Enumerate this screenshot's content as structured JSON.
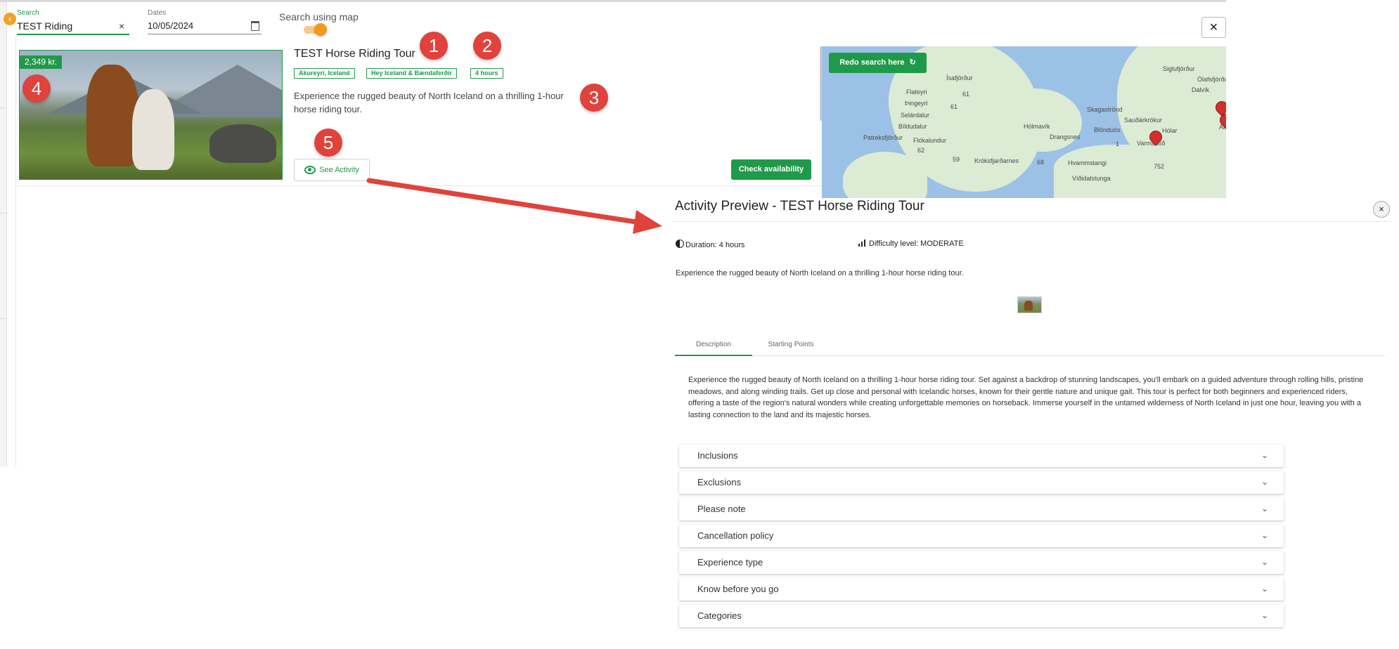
{
  "search": {
    "label": "Search",
    "value": "TEST Riding",
    "clear_icon": "×",
    "dates_label": "Dates",
    "dates_value": "10/05/2024",
    "map_toggle_label": "Search using map",
    "map_toggle_on": true,
    "close_icon": "×"
  },
  "result": {
    "price": "2,349 kr.",
    "title": "TEST Horse Riding Tour",
    "tags": [
      "Akureyri, Iceland",
      "Hey Iceland & Bændaferðir",
      "4 hours"
    ],
    "description": "Experience the rugged beauty of North Iceland on a thrilling 1-hour horse riding tour.",
    "see_activity_label": "See Activity",
    "check_availability_label": "Check availability"
  },
  "map": {
    "redo_label": "Redo search here",
    "places": [
      "Siglufjörður",
      "Ólafsfjörður",
      "Dalvík",
      "Ísafjörður",
      "Flateyri",
      "Þingeyri",
      "Hólmavík",
      "Skagaströnd",
      "Sauðárkrókur",
      "Selárdalur",
      "Bíldudalur",
      "Blönduós",
      "Hólar",
      "Patreksfjörður",
      "Flókalundur",
      "Drangsnes",
      "Varmahlíð",
      "Hvammstangi",
      "Króksfjarðarnes",
      "Víðidalstunga",
      "Ak"
    ],
    "roads": [
      "61",
      "61",
      "1",
      "59",
      "68",
      "62",
      "752"
    ]
  },
  "callouts": [
    "1",
    "2",
    "3",
    "4",
    "5"
  ],
  "preview": {
    "title": "Activity Preview - TEST Horse Riding Tour",
    "duration": "Duration: 4 hours",
    "difficulty": "Difficulty level: MODERATE",
    "short_description": "Experience the rugged beauty of North Iceland on a thrilling 1-hour horse riding tour.",
    "tabs": [
      "Description",
      "Starting Points"
    ],
    "active_tab": "Description",
    "long_description": "Experience the rugged beauty of North Iceland on a thrilling 1-hour horse riding tour. Set against a backdrop of stunning landscapes, you'll embark on a guided adventure through rolling hills, pristine meadows, and along winding trails. Get up close and personal with Icelandic horses, known for their gentle nature and unique gait. This tour is perfect for both beginners and experienced riders, offering a taste of the region's natural wonders while creating unforgettable memories on horseback. Immerse yourself in the untamed wilderness of North Iceland in just one hour, leaving you with a lasting connection to the land and its majestic horses.",
    "sections": [
      "Inclusions",
      "Exclusions",
      "Please note",
      "Cancellation policy",
      "Experience type",
      "Know before you go",
      "Categories"
    ],
    "chevron": "⌄",
    "close_icon": "×"
  },
  "colors": {
    "accent_green": "#1f9a4a",
    "toggle_orange": "#f39a1e",
    "callout_red": "#e0423c",
    "pin_red": "#d32f2f"
  }
}
